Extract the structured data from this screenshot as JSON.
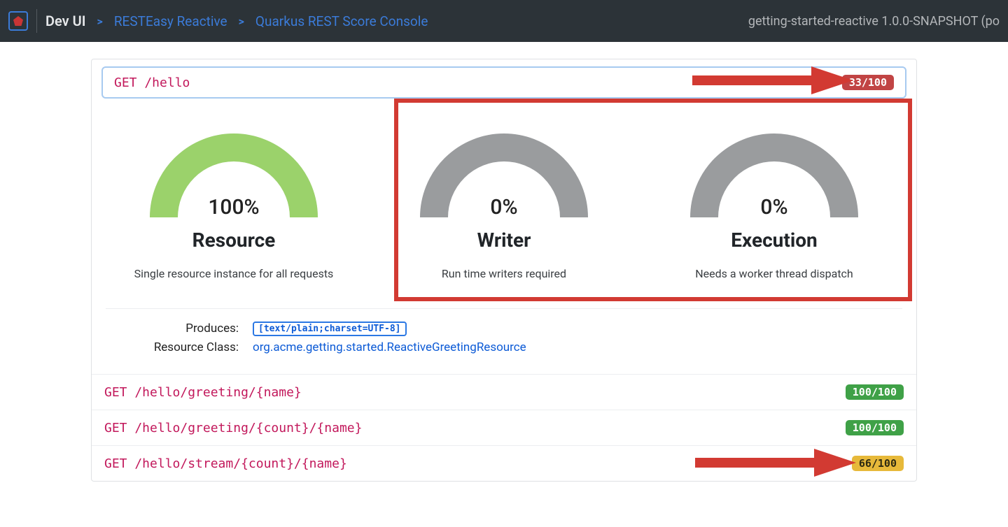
{
  "header": {
    "brand": "Dev UI",
    "crumb1": "RESTEasy Reactive",
    "crumb2": "Quarkus REST Score Console",
    "app_meta": "getting-started-reactive 1.0.0-SNAPSHOT (po"
  },
  "endpoints": [
    {
      "path": "GET /hello",
      "score": "33/100",
      "score_level": "red",
      "expanded": true,
      "gauges": [
        {
          "title": "Resource",
          "percent": 100,
          "percent_label": "100%",
          "sub": "Single resource instance for all requests",
          "color": "#9bd26b"
        },
        {
          "title": "Writer",
          "percent": 0,
          "percent_label": "0%",
          "sub": "Run time writers required",
          "color": "#9a9c9e"
        },
        {
          "title": "Execution",
          "percent": 0,
          "percent_label": "0%",
          "sub": "Needs a worker thread dispatch",
          "color": "#9a9c9e"
        }
      ],
      "meta": {
        "produces_label": "Produces:",
        "produces_value": "[text/plain;charset=UTF-8]",
        "class_label": "Resource Class:",
        "class_value": "org.acme.getting.started.ReactiveGreetingResource"
      }
    },
    {
      "path": "GET /hello/greeting/{name}",
      "score": "100/100",
      "score_level": "green"
    },
    {
      "path": "GET /hello/greeting/{count}/{name}",
      "score": "100/100",
      "score_level": "green"
    },
    {
      "path": "GET /hello/stream/{count}/{name}",
      "score": "66/100",
      "score_level": "yellow"
    }
  ]
}
